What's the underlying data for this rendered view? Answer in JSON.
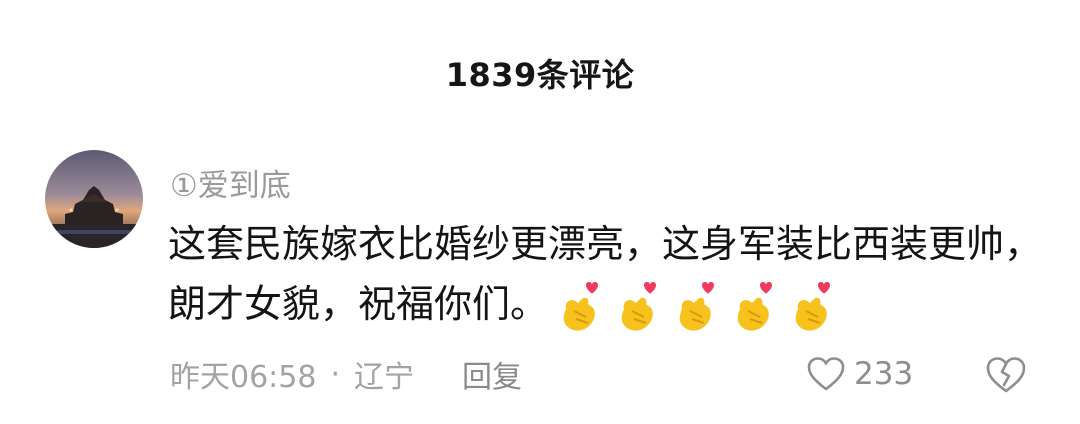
{
  "header": {
    "title": "1839条评论"
  },
  "comment": {
    "avatar_icon": "palace-tower-sunset-avatar",
    "username": "①爱到底",
    "text": "这套民族嫁衣比婚纱更漂亮，这身军装比西装更帅，朗才女貌，祝福你们。",
    "emojis": [
      "heart-finger-emoji",
      "heart-finger-emoji",
      "heart-finger-emoji",
      "heart-finger-emoji",
      "heart-finger-emoji"
    ],
    "time": "昨天06:58",
    "separator": "·",
    "location": "辽宁",
    "reply_label": "回复",
    "like_icon": "heart-outline-icon",
    "like_count": "233",
    "dislike_icon": "broken-heart-icon"
  },
  "colors": {
    "primary_text": "#141414",
    "secondary_text": "#9a9a9a",
    "emoji_hand": "#f7c21d",
    "emoji_heart": "#f03a5f"
  }
}
